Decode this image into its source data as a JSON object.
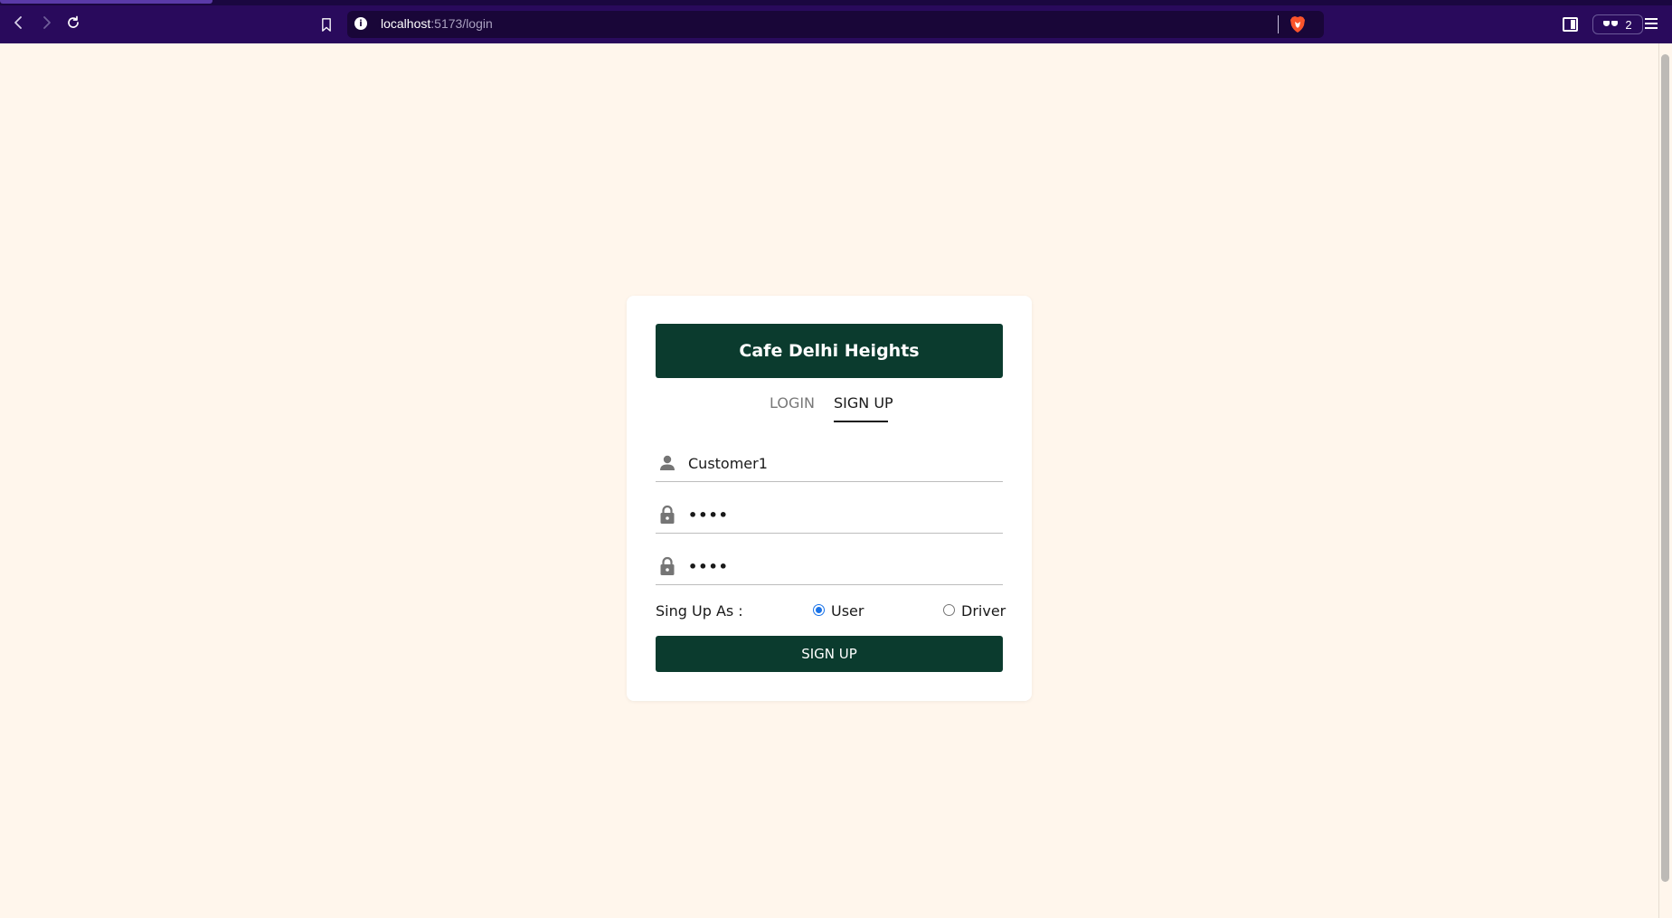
{
  "browser": {
    "url_host": "localhost",
    "url_path": ":5173/login",
    "wallet_count": "2"
  },
  "card": {
    "brand_title": "Cafe Delhi Heights",
    "tabs": [
      {
        "label": "LOGIN",
        "active": false
      },
      {
        "label": "SIGN UP",
        "active": true
      }
    ],
    "username_value": "Customer1",
    "password_value": "••••",
    "confirm_password_value": "••••",
    "role_label": "Sing Up As :",
    "role_options": [
      {
        "label": "User",
        "checked": true
      },
      {
        "label": "Driver",
        "checked": false
      }
    ],
    "submit_label": "SIGN UP"
  },
  "colors": {
    "background": "#fff6ec",
    "brand": "#0b3b2e",
    "chrome": "#290a5c"
  }
}
